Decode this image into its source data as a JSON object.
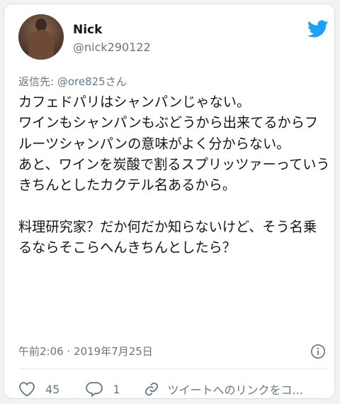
{
  "user": {
    "name": "Nick",
    "handle": "@nick290122"
  },
  "reply_to": "返信先: @ore825さん",
  "tweet": {
    "text": "カフェドパリはシャンパンじゃない。\nワインもシャンパンもぶどうから出来てるからフルーツシャンパンの意味がよく分からない。\nあと、ワインを炭酸で割るスプリッツァーっていうきちんとしたカクテル名あるから。\n\n料理研究家？だか何だか知らないけど、そう名乗るならそこらへんきちんとしたら？"
  },
  "meta": {
    "timestamp": "午前2:06 · 2019年7月25日"
  },
  "actions": {
    "like_count": "45",
    "reply_count": "1",
    "share_label": "ツイートへのリンクをコ..."
  },
  "colors": {
    "brand": "#1da1f2",
    "text": "#14171a",
    "secondary": "#657786"
  },
  "icons": [
    "twitter-bird-icon",
    "info-icon",
    "heart-icon",
    "reply-icon",
    "link-icon"
  ]
}
